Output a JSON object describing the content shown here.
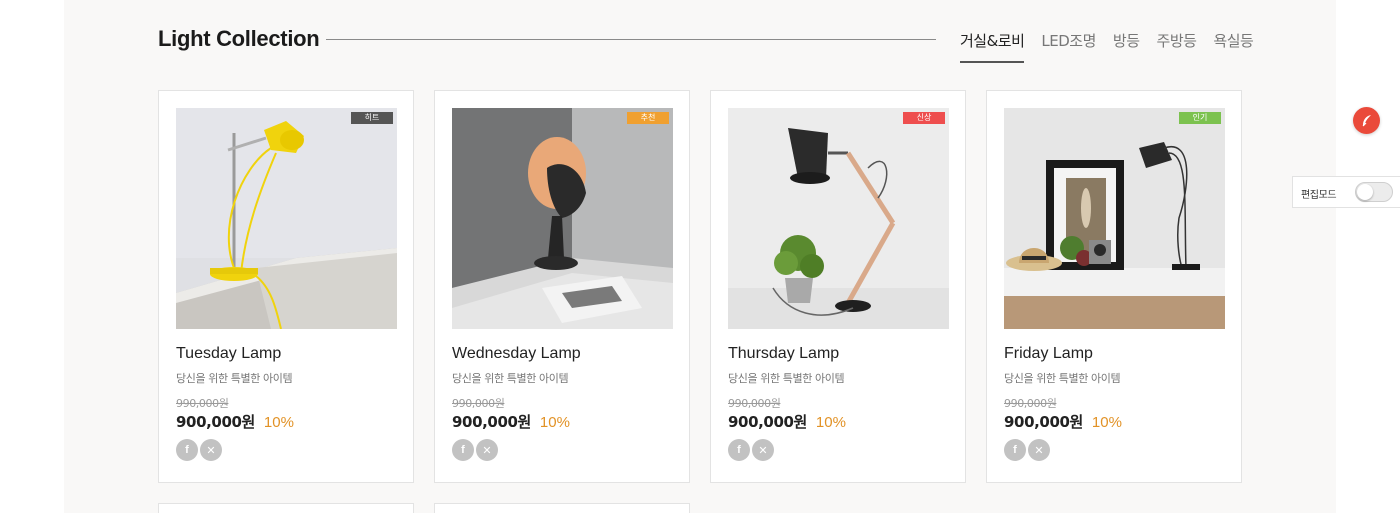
{
  "section": {
    "title": "Light Collection"
  },
  "tabs": [
    {
      "label": "거실&로비",
      "active": true
    },
    {
      "label": "LED조명",
      "active": false
    },
    {
      "label": "방등",
      "active": false
    },
    {
      "label": "주방등",
      "active": false
    },
    {
      "label": "욕실등",
      "active": false
    }
  ],
  "products": [
    {
      "name": "Tuesday Lamp",
      "desc": "당신을 위한 특별한 아이템",
      "original_price": "990,000원",
      "price": "900,000원",
      "discount": "10%",
      "badge": "히트",
      "badge_color": "#555555",
      "image": "yellow-desk-lamp"
    },
    {
      "name": "Wednesday Lamp",
      "desc": "당신을 위한 특별한 아이템",
      "original_price": "990,000원",
      "price": "900,000원",
      "discount": "10%",
      "badge": "추천",
      "badge_color": "#f0a030",
      "image": "egg-table-lamp"
    },
    {
      "name": "Thursday Lamp",
      "desc": "당신을 위한 특별한 아이템",
      "original_price": "990,000원",
      "price": "900,000원",
      "discount": "10%",
      "badge": "신상",
      "badge_color": "#ee4e4e",
      "image": "copper-arm-lamp"
    },
    {
      "name": "Friday Lamp",
      "desc": "당신을 위한 특별한 아이템",
      "original_price": "990,000원",
      "price": "900,000원",
      "discount": "10%",
      "badge": "인기",
      "badge_color": "#7cc24f",
      "image": "black-wire-lamp"
    }
  ],
  "social_icons": [
    "facebook-icon",
    "x-icon"
  ],
  "social_glyphs": {
    "facebook": "f",
    "x": "✕"
  },
  "edit_mode": {
    "label": "편집모드",
    "enabled": false
  },
  "colors": {
    "accent_discount": "#e29226",
    "fab": "#ea4a3a"
  }
}
